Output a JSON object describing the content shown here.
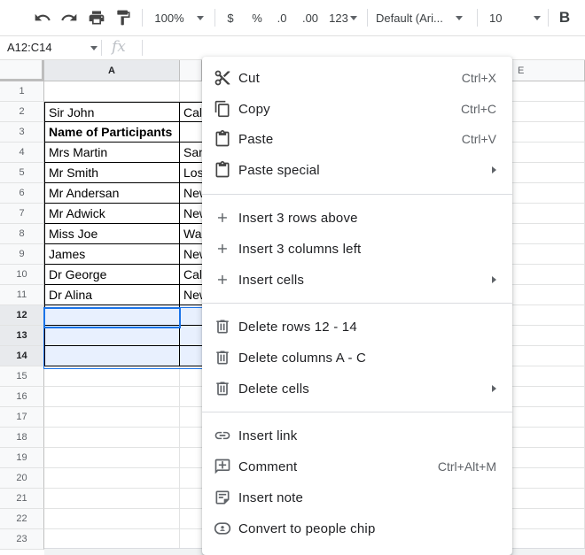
{
  "toolbar": {
    "zoom": "100%",
    "currency": "$",
    "percent": "%",
    "dec_decrease": ".0",
    "dec_increase": ".00",
    "more_formats": "123",
    "font": "Default (Ari...",
    "font_size": "10",
    "bold": "B"
  },
  "formula_bar": {
    "name_box": "A12:C14",
    "fx": "fx"
  },
  "columns": {
    "a": "A",
    "e": "E"
  },
  "rows": [
    "1",
    "2",
    "3",
    "4",
    "5",
    "6",
    "7",
    "8",
    "9",
    "10",
    "11",
    "12",
    "13",
    "14",
    "15",
    "16",
    "17",
    "18",
    "19",
    "20",
    "21",
    "22",
    "23"
  ],
  "col_a": [
    "",
    "Sir John",
    "Name of Participants",
    "Mrs Martin",
    "Mr Smith",
    "Mr Andersan",
    "Mr Adwick",
    "Miss Joe",
    "James",
    "Dr George",
    "Dr Alina"
  ],
  "col_b": [
    "",
    "Cal",
    "",
    "San",
    "Los",
    "New",
    "New",
    "Wa",
    "New",
    "Cal",
    "New"
  ],
  "menu": {
    "cut": {
      "label": "Cut",
      "shortcut": "Ctrl+X"
    },
    "copy": {
      "label": "Copy",
      "shortcut": "Ctrl+C"
    },
    "paste": {
      "label": "Paste",
      "shortcut": "Ctrl+V"
    },
    "paste_special": {
      "label": "Paste special"
    },
    "insert_rows": {
      "label": "Insert 3 rows above"
    },
    "insert_cols": {
      "label": "Insert 3 columns left"
    },
    "insert_cells": {
      "label": "Insert cells"
    },
    "delete_rows": {
      "label": "Delete rows 12 - 14"
    },
    "delete_cols": {
      "label": "Delete columns A - C"
    },
    "delete_cells": {
      "label": "Delete cells"
    },
    "insert_link": {
      "label": "Insert link"
    },
    "comment": {
      "label": "Comment",
      "shortcut": "Ctrl+Alt+M"
    },
    "insert_note": {
      "label": "Insert note"
    },
    "people_chip": {
      "label": "Convert to people chip"
    }
  },
  "colors": {
    "accent": "#1a73e8",
    "selection": "#e8f0fe"
  }
}
